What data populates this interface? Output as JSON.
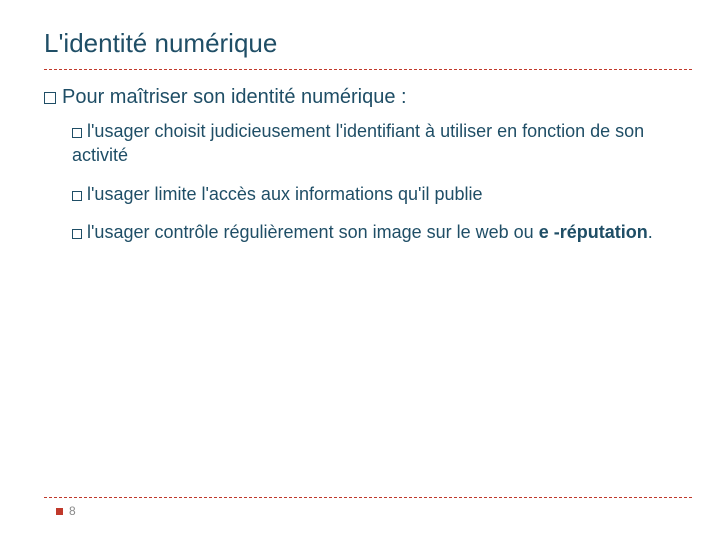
{
  "slide": {
    "title": "L'identité numérique",
    "main_bullet": "Pour maîtriser son identité numérique :",
    "sub_bullets": [
      {
        "text": "l'usager choisit judicieusement l'identifiant à utiliser en fonction de son activité"
      },
      {
        "text": "l'usager limite l'accès aux informations qu'il publie"
      },
      {
        "parts": [
          {
            "text": "l'usager contrôle régulièrement son image sur le web ou ",
            "bold": false
          },
          {
            "text": "e -réputation",
            "bold": true
          },
          {
            "text": ".",
            "bold": false
          }
        ]
      }
    ],
    "page_number": "8"
  }
}
